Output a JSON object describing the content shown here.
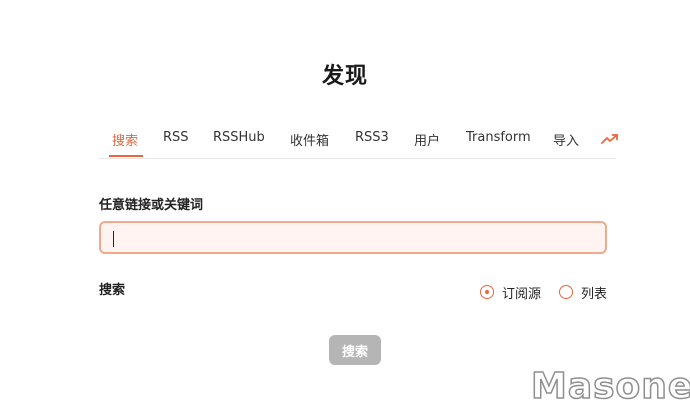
{
  "page": {
    "title": "发现"
  },
  "tabs": [
    {
      "label": "搜索",
      "active": true
    },
    {
      "label": "RSS",
      "active": false
    },
    {
      "label": "RSSHub",
      "active": false
    },
    {
      "label": "收件箱",
      "active": false
    },
    {
      "label": "RSS3",
      "active": false
    },
    {
      "label": "用户",
      "active": false
    },
    {
      "label": "Transform",
      "active": false
    },
    {
      "label": "导入",
      "active": false
    }
  ],
  "tabs_overflow_icon": "trending-up-icon",
  "form": {
    "keyword_label": "任意链接或关键词",
    "keyword_value": "",
    "keyword_placeholder": "",
    "search_type_label": "搜索",
    "search_type_options": [
      {
        "label": "订阅源",
        "selected": true
      },
      {
        "label": "列表",
        "selected": false
      }
    ],
    "submit_label": "搜索",
    "submit_enabled": false
  },
  "watermark": "Masone",
  "colors": {
    "accent": "#e8663d",
    "input_border": "#f2a98e",
    "input_background": "#fff4f1",
    "disabled_button": "#b5b5b5"
  }
}
